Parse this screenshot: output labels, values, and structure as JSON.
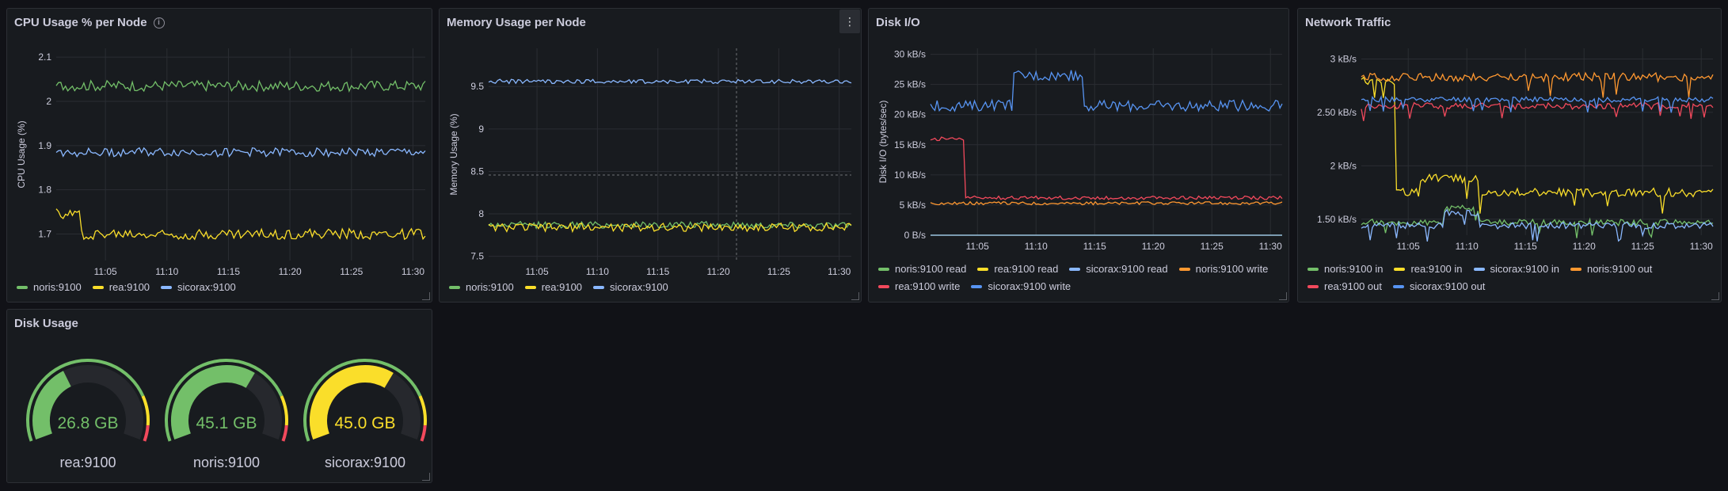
{
  "panels": {
    "cpu": {
      "title": "CPU Usage % per Node"
    },
    "memory": {
      "title": "Memory Usage per Node"
    },
    "disk_io": {
      "title": "Disk I/O"
    },
    "network": {
      "title": "Network Traffic"
    },
    "disk_usage": {
      "title": "Disk Usage"
    }
  },
  "colors": {
    "green": "#73bf69",
    "yellow": "#fade2a",
    "blue": "#8ab8ff",
    "orange": "#ff9830",
    "red": "#f2495c",
    "darkblue": "#5794f2"
  },
  "chart_data": [
    {
      "id": "cpu",
      "type": "line",
      "title": "CPU Usage % per Node",
      "ylabel": "CPU Usage (%)",
      "ylim": [
        1.64,
        2.12
      ],
      "yticks": [
        "1.7",
        "1.8",
        "1.9",
        "2",
        "2.1"
      ],
      "ytick_values": [
        1.7,
        1.8,
        1.9,
        2.0,
        2.1
      ],
      "xticks": [
        "11:05",
        "11:10",
        "11:15",
        "11:20",
        "11:25",
        "11:30"
      ],
      "xlim": [
        "11:01",
        "11:31"
      ],
      "grid": true,
      "legend": "bottom",
      "series": [
        {
          "name": "noris:9100",
          "color": "green",
          "baseline": 2.035,
          "noise": 0.012,
          "jumps": []
        },
        {
          "name": "rea:9100",
          "color": "yellow",
          "baseline": 1.7,
          "noise": 0.012,
          "jumps": [
            {
              "until": "11:03",
              "value": 1.745
            }
          ]
        },
        {
          "name": "sicorax:9100",
          "color": "blue",
          "baseline": 1.885,
          "noise": 0.01,
          "jumps": []
        }
      ]
    },
    {
      "id": "memory",
      "type": "line",
      "title": "Memory Usage per Node",
      "ylabel": "Memory Usage (%)",
      "ylim": [
        7.45,
        9.95
      ],
      "yticks": [
        "7.5",
        "8",
        "8.5",
        "9",
        "9.5"
      ],
      "ytick_values": [
        7.5,
        8.0,
        8.5,
        9.0,
        9.5
      ],
      "xticks": [
        "11:05",
        "11:10",
        "11:15",
        "11:20",
        "11:25",
        "11:30"
      ],
      "xlim": [
        "11:01",
        "11:31"
      ],
      "grid": true,
      "legend": "bottom",
      "series": [
        {
          "name": "noris:9100",
          "color": "green",
          "baseline": 7.87,
          "noise": 0.04,
          "jumps": []
        },
        {
          "name": "rea:9100",
          "color": "yellow",
          "baseline": 7.84,
          "noise": 0.05,
          "jumps": []
        },
        {
          "name": "sicorax:9100",
          "color": "blue",
          "baseline": 9.56,
          "noise": 0.025,
          "jumps": []
        }
      ]
    },
    {
      "id": "disk_io",
      "type": "line",
      "title": "Disk I/O",
      "ylabel": "Disk I/O (bytes/sec)",
      "ylim": [
        0,
        31000
      ],
      "yticks": [
        "0 B/s",
        "5 kB/s",
        "10 kB/s",
        "15 kB/s",
        "20 kB/s",
        "25 kB/s",
        "30 kB/s"
      ],
      "ytick_values": [
        0,
        5000,
        10000,
        15000,
        20000,
        25000,
        30000
      ],
      "xticks": [
        "11:05",
        "11:10",
        "11:15",
        "11:20",
        "11:25",
        "11:30"
      ],
      "xlim": [
        "11:01",
        "11:31"
      ],
      "grid": true,
      "legend": "bottom",
      "series": [
        {
          "name": "noris:9100 read",
          "color": "green",
          "baseline": 0,
          "noise": 0,
          "jumps": []
        },
        {
          "name": "rea:9100 read",
          "color": "yellow",
          "baseline": 0,
          "noise": 0,
          "jumps": []
        },
        {
          "name": "sicorax:9100 read",
          "color": "blue",
          "baseline": 0,
          "noise": 0,
          "jumps": []
        },
        {
          "name": "noris:9100 write",
          "color": "orange",
          "baseline": 5300,
          "noise": 250,
          "jumps": []
        },
        {
          "name": "rea:9100 write",
          "color": "red",
          "baseline": 6200,
          "noise": 300,
          "jumps": [
            {
              "until": "11:04",
              "value": 16000
            }
          ]
        },
        {
          "name": "sicorax:9100 write",
          "color": "darkblue",
          "baseline": 21500,
          "noise": 900,
          "jumps": [
            {
              "from": "11:08",
              "until": "11:14",
              "value": 26500
            }
          ]
        }
      ]
    },
    {
      "id": "network",
      "type": "line",
      "title": "Network Traffic",
      "ylabel": "",
      "ylim": [
        1350,
        3100
      ],
      "yticks": [
        "1.50 kB/s",
        "2 kB/s",
        "2.50 kB/s",
        "3 kB/s"
      ],
      "ytick_values": [
        1500,
        2000,
        2500,
        3000
      ],
      "xticks": [
        "11:05",
        "11:10",
        "11:15",
        "11:20",
        "11:25",
        "11:30"
      ],
      "xlim": [
        "11:01",
        "11:31"
      ],
      "grid": true,
      "legend": "bottom",
      "series": [
        {
          "name": "noris:9100 in",
          "color": "green",
          "baseline": 1470,
          "noise": 30,
          "jumps": [
            {
              "from": "11:08",
              "until": "11:11",
              "value": 1600
            }
          ]
        },
        {
          "name": "rea:9100 in",
          "color": "yellow",
          "baseline": 1750,
          "noise": 40,
          "jumps": [
            {
              "until": "11:04",
              "value": 2800
            },
            {
              "from": "11:06",
              "until": "11:11",
              "value": 1880
            }
          ]
        },
        {
          "name": "sicorax:9100 in",
          "color": "blue",
          "baseline": 1440,
          "noise": 30,
          "jumps": [
            {
              "from": "11:08",
              "until": "11:11",
              "value": 1560
            }
          ]
        },
        {
          "name": "noris:9100 out",
          "color": "orange",
          "baseline": 2830,
          "noise": 40,
          "jumps": []
        },
        {
          "name": "rea:9100 out",
          "color": "red",
          "baseline": 2560,
          "noise": 30,
          "jumps": []
        },
        {
          "name": "sicorax:9100 out",
          "color": "darkblue",
          "baseline": 2620,
          "noise": 25,
          "jumps": []
        }
      ]
    }
  ],
  "gauges": [
    {
      "label": "rea:9100",
      "value_text": "26.8 GB",
      "fraction": 0.38,
      "color": "green"
    },
    {
      "label": "noris:9100",
      "value_text": "45.1 GB",
      "fraction": 0.64,
      "color": "green"
    },
    {
      "label": "sicorax:9100",
      "value_text": "45.0 GB",
      "fraction": 0.64,
      "color": "yellow"
    }
  ]
}
